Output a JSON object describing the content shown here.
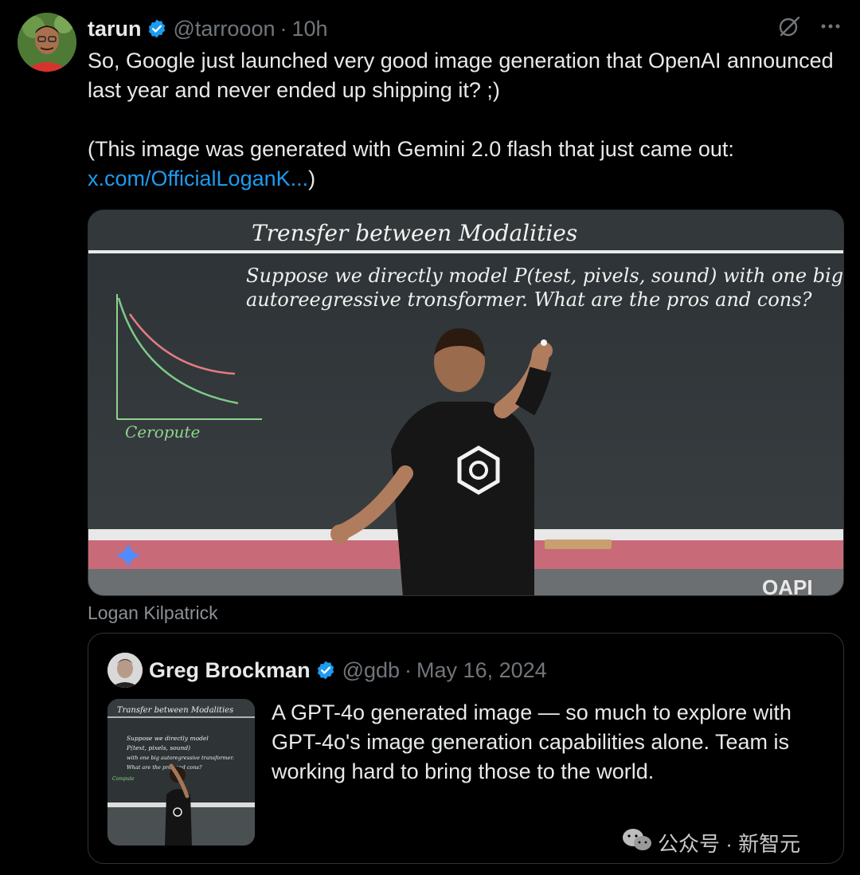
{
  "tweet": {
    "author_name": "tarun",
    "handle": "@tarrooon",
    "separator": "·",
    "time": "10h",
    "text_line1": "So, Google just launched very good image generation that OpenAI announced last year and never ended up shipping it? ;)",
    "text_line2": "(This image was generated with Gemini 2.0 flash that just came out:",
    "link_text": "x.com/OfficialLoganK...",
    "link_suffix": ")",
    "media": {
      "board_title": "Trensfer between Modalities",
      "board_line1": "Suppose we directly model P(test, pivels, sound) with one big",
      "board_line2": "autoreegressive tronsformer. What are the pros and cons?",
      "graph_label": "Ceropute",
      "corner_mark": "OAPI"
    },
    "media_caption": "Logan Kilpatrick"
  },
  "quote": {
    "author_name": "Greg Brockman",
    "handle": "@gdb",
    "separator": "·",
    "date": "May 16, 2024",
    "text": "A GPT-4o generated image — so much to explore with GPT-4o's image generation capabilities alone. Team is working hard to bring those to the world.",
    "thumb": {
      "title": "Transfer between Modalities",
      "line1": "Suppose we directly model",
      "line2": "P(text, pixels, sound)",
      "line3": "with one big autoregressive transformer.",
      "line4": "What are the pros and cons?",
      "label": "Compute"
    }
  },
  "watermark": {
    "text": "公众号 · 新智元"
  },
  "colors": {
    "background": "#000000",
    "text": "#e7e9ea",
    "muted": "#71767b",
    "link": "#1d9bf0",
    "verified": "#1d9bf0",
    "border": "#2f3336"
  },
  "icons": [
    "verified-badge-icon",
    "grok-icon",
    "more-icon",
    "wechat-icon",
    "gemini-sparkle-icon"
  ]
}
